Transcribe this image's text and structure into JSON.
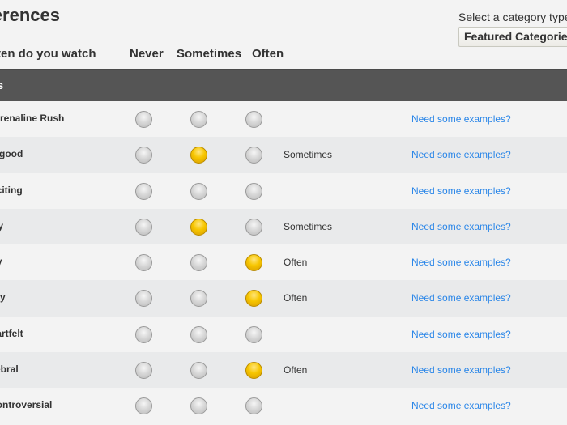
{
  "header": {
    "title": "Preferences",
    "category_label": "Select a category type",
    "category_selected": "Featured Categories"
  },
  "columns": {
    "question": "How often do you watch",
    "never": "Never",
    "sometimes": "Sometimes",
    "often": "Often"
  },
  "section": {
    "title": "Moods"
  },
  "rows": [
    {
      "label": "Adrenaline Rush",
      "selected": "",
      "status": "",
      "link": "Need some examples?"
    },
    {
      "label": "Feel-good",
      "selected": "sometimes",
      "status": "Sometimes",
      "link": "Need some examples?"
    },
    {
      "label": "Exciting",
      "selected": "",
      "status": "",
      "link": "Need some examples?"
    },
    {
      "label": "Quirky",
      "selected": "sometimes",
      "status": "Sometimes",
      "link": "Need some examples?"
    },
    {
      "label": "Scary",
      "selected": "often",
      "status": "Often",
      "link": "Need some examples?"
    },
    {
      "label": "Creepy",
      "selected": "often",
      "status": "Often",
      "link": "Need some examples?"
    },
    {
      "label": "Heartfelt",
      "selected": "",
      "status": "",
      "link": "Need some examples?"
    },
    {
      "label": "Cerebral",
      "selected": "often",
      "status": "Often",
      "link": "Need some examples?"
    },
    {
      "label": "Controversial",
      "selected": "",
      "status": "",
      "link": "Need some examples?"
    }
  ],
  "colors": {
    "section_bar": "#555555",
    "link": "#2a86e8",
    "selected_radio": "#f7c600"
  }
}
